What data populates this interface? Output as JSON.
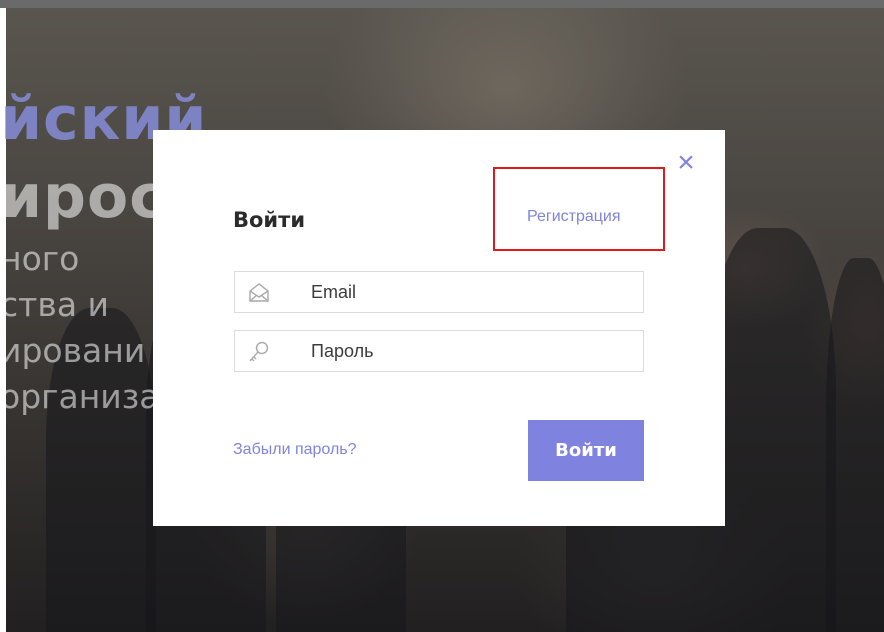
{
  "background": {
    "hero_title_lines": [
      "йский",
      "ирос"
    ],
    "hero_subtitle_lines": [
      "ного",
      "ства и",
      "ировани",
      "организа"
    ]
  },
  "modal": {
    "title": "Войти",
    "close_glyph": "×",
    "register_link": "Регистрация",
    "email": {
      "placeholder": "Email",
      "value": "",
      "icon": "envelope-icon"
    },
    "password": {
      "placeholder": "Пароль",
      "value": "",
      "icon": "key-icon"
    },
    "forgot_link": "Забыли пароль?",
    "submit_label": "Войти"
  },
  "colors": {
    "accent": "#7f84dc",
    "button": "#7f82df",
    "highlight": "#e01a1a",
    "overlay": "rgba(20,20,25,0.42)"
  }
}
